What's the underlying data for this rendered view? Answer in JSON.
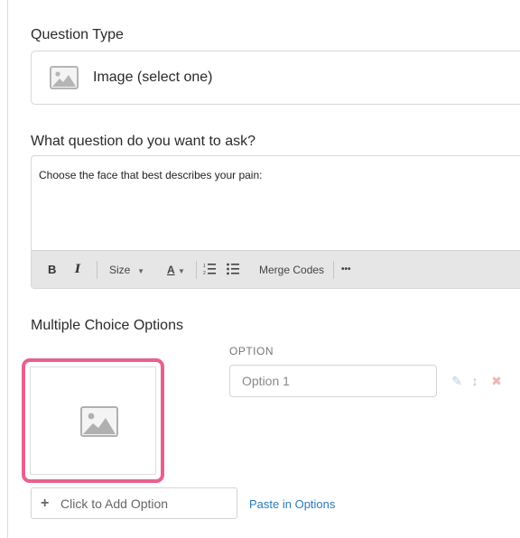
{
  "question_type": {
    "label": "Question Type",
    "selected": "Image (select one)",
    "icon": "image-icon"
  },
  "question": {
    "label": "What question do you want to ask?",
    "text": "Choose the face that best describes your pain:",
    "toolbar": {
      "bold": "B",
      "italic": "I",
      "size": "Size",
      "font_color": "A",
      "merge_codes": "Merge Codes",
      "more": "•••",
      "numbered_list_icon": "numbered-list-icon",
      "bulleted_list_icon": "bulleted-list-icon"
    }
  },
  "options": {
    "label": "Multiple Choice Options",
    "column_header": "OPTION",
    "items": [
      {
        "placeholder": "Option 1",
        "value": ""
      }
    ],
    "add_option": "Click to Add Option",
    "paste_options": "Paste in Options"
  },
  "colors": {
    "highlight": "#e8618c",
    "link": "#2b7bb9",
    "toolbar_bg": "#e6e6e6"
  }
}
